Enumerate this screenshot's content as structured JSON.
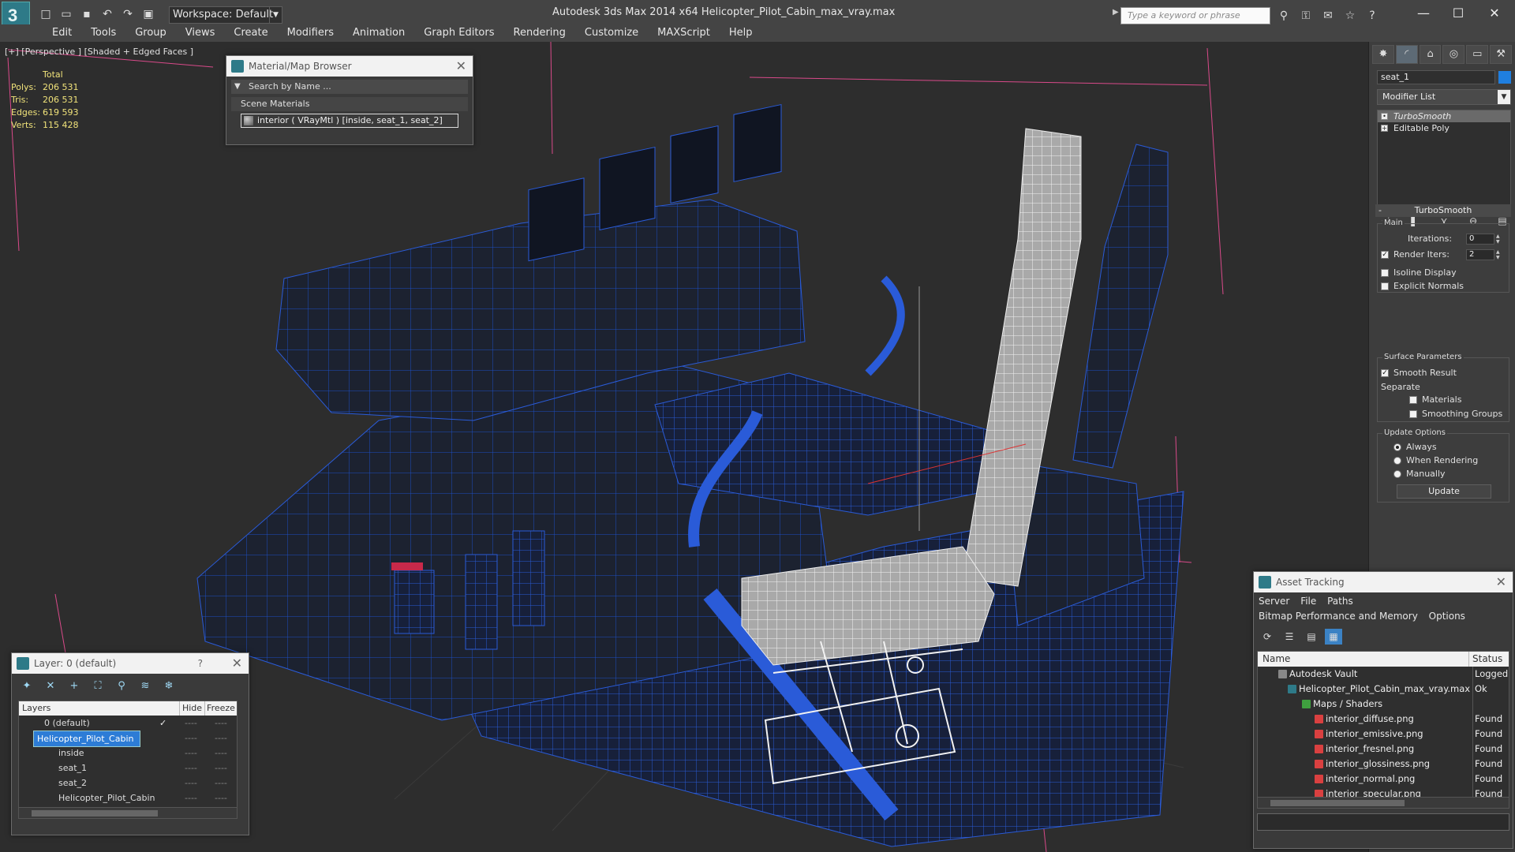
{
  "titlebar": {
    "workspace": "Workspace: Default",
    "app_title": "Autodesk 3ds Max  2014 x64      Helicopter_Pilot_Cabin_max_vray.max",
    "search_placeholder": "Type a keyword or phrase",
    "icons": [
      "new-file-icon",
      "open-icon",
      "save-icon",
      "undo-icon",
      "redo-icon",
      "project-icon"
    ]
  },
  "menu": [
    "Edit",
    "Tools",
    "Group",
    "Views",
    "Create",
    "Modifiers",
    "Animation",
    "Graph Editors",
    "Rendering",
    "Customize",
    "MAXScript",
    "Help"
  ],
  "viewport": {
    "label": "[+] [Perspective ] [Shaded + Edged Faces ]",
    "stats": {
      "header": "Total",
      "rows": [
        {
          "label": "Polys:",
          "value": "206 531"
        },
        {
          "label": "Tris:",
          "value": "206 531"
        },
        {
          "label": "Edges:",
          "value": "619 593"
        },
        {
          "label": "Verts:",
          "value": "115 428"
        }
      ]
    }
  },
  "material_browser": {
    "title": "Material/Map Browser",
    "search": "Search by Name ...",
    "section": "Scene Materials",
    "item": "interior  ( VRayMtl ) [inside, seat_1, seat_2]"
  },
  "command_panel": {
    "object_name": "seat_1",
    "object_color": "#1f7fe0",
    "modifier_list": "Modifier List",
    "stack": [
      "TurboSmooth",
      "Editable Poly"
    ],
    "rollout_title": "TurboSmooth",
    "main_label": "Main",
    "iterations_label": "Iterations:",
    "iterations_value": "0",
    "render_iters_label": "Render Iters:",
    "render_iters_value": "2",
    "isoline_label": "Isoline Display",
    "explicit_label": "Explicit Normals",
    "surface_label": "Surface Parameters",
    "smooth_label": "Smooth Result",
    "separate_label": "Separate",
    "materials_label": "Materials",
    "smoothing_label": "Smoothing Groups",
    "update_label": "Update Options",
    "always_label": "Always",
    "when_rendering_label": "When Rendering",
    "manually_label": "Manually",
    "update_button": "Update"
  },
  "layer_panel": {
    "title": "Layer: 0 (default)",
    "help": "?",
    "col_layers": "Layers",
    "col_hide": "Hide",
    "col_freeze": "Freeze",
    "rows": [
      "0 (default)",
      "Helicopter_Pilot_Cabin",
      "inside",
      "seat_1",
      "seat_2",
      "Helicopter_Pilot_Cabin"
    ],
    "hide_dash": "----",
    "freeze_dash": "----"
  },
  "asset_panel": {
    "title": "Asset Tracking",
    "menu": [
      "Server",
      "File",
      "Paths",
      "Bitmap Performance and Memory",
      "Options"
    ],
    "col_name": "Name",
    "col_status": "Status",
    "rows": [
      {
        "name": "Autodesk Vault",
        "status": "Logged"
      },
      {
        "name": "Helicopter_Pilot_Cabin_max_vray.max",
        "status": "Ok"
      },
      {
        "name": "Maps / Shaders",
        "status": ""
      },
      {
        "name": "interior_diffuse.png",
        "status": "Found"
      },
      {
        "name": "interior_emissive.png",
        "status": "Found"
      },
      {
        "name": "interior_fresnel.png",
        "status": "Found"
      },
      {
        "name": "interior_glossiness.png",
        "status": "Found"
      },
      {
        "name": "interior_normal.png",
        "status": "Found"
      },
      {
        "name": "interior_specular.png",
        "status": "Found"
      }
    ]
  }
}
